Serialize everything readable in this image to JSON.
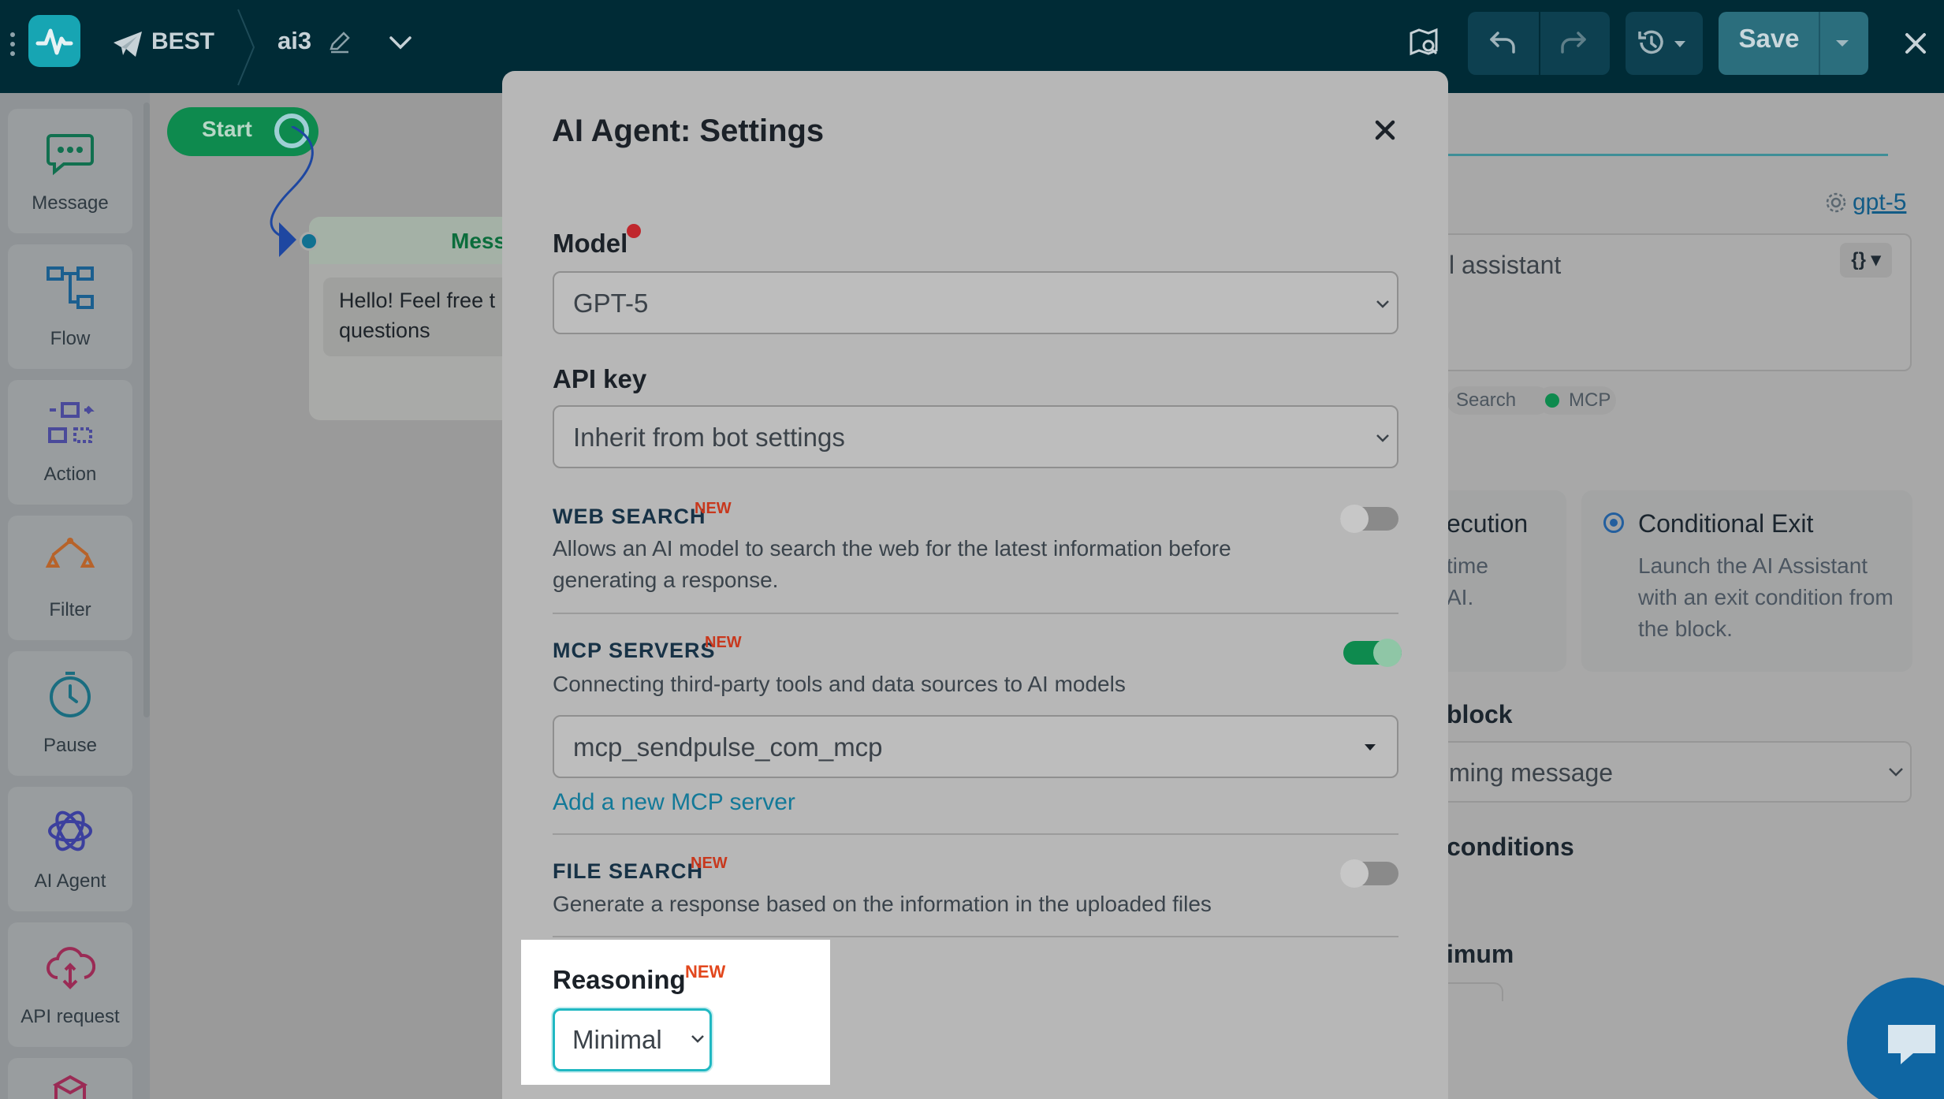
{
  "header": {
    "bot_name": "BEST",
    "flow_name": "ai3",
    "save_label": "Save",
    "icons": [
      "kebab-icon",
      "app-logo-icon",
      "telegram-icon",
      "pencil-icon",
      "chevron-down-icon",
      "map-icon",
      "undo-icon",
      "redo-icon",
      "history-icon",
      "close-icon"
    ]
  },
  "sidebar": {
    "items": [
      {
        "label": "Message",
        "icon": "chat-bubble-icon"
      },
      {
        "label": "Flow",
        "icon": "flow-icon"
      },
      {
        "label": "Action",
        "icon": "action-icon"
      },
      {
        "label": "Filter",
        "icon": "filter-icon"
      },
      {
        "label": "Pause",
        "icon": "clock-icon"
      },
      {
        "label": "AI Agent",
        "icon": "ai-agent-icon"
      },
      {
        "label": "API request",
        "icon": "api-cloud-icon"
      }
    ]
  },
  "canvas": {
    "start_label": "Start",
    "message_node_title": "Mess",
    "message_node_text": "Hello! Feel free t questions"
  },
  "right_panel": {
    "model_link": "gpt-5",
    "prompt_text": "l assistant",
    "prompt_button": "{}",
    "chips": [
      "Search",
      "MCP"
    ],
    "option_left_title": "ecution",
    "option_left_desc": "time AI.",
    "option_right_title": "Conditional Exit",
    "option_right_desc": "Launch the AI Assistant with an exit condition from the block.",
    "block_heading": "block",
    "block_select": "ming message",
    "conditions_heading": "conditions",
    "minimum_heading": "imum"
  },
  "modal": {
    "title": "AI Agent: Settings",
    "model": {
      "label": "Model",
      "value": "GPT-5"
    },
    "api_key": {
      "label": "API key",
      "value": "Inherit from bot settings"
    },
    "web_search": {
      "label": "WEB SEARCH",
      "badge": "NEW",
      "description": "Allows an AI model to search the web for the latest information before generating a response.",
      "enabled": false
    },
    "mcp_servers": {
      "label": "MCP SERVERS",
      "badge": "NEW",
      "description": "Connecting third-party tools and data sources to AI models",
      "enabled": true,
      "selected": "mcp_sendpulse_com_mcp",
      "add_link": "Add a new MCP server"
    },
    "file_search": {
      "label": "FILE SEARCH",
      "badge": "NEW",
      "description": "Generate a response based on the information in the uploaded files",
      "enabled": false
    },
    "reasoning": {
      "label": "Reasoning",
      "badge": "NEW",
      "value": "Minimal"
    }
  },
  "colors": {
    "topbar": "#002b36",
    "accent_teal": "#20b8c2",
    "toggle_on": "#0e8a4e",
    "new_badge": "#e2471d",
    "link": "#137998"
  }
}
